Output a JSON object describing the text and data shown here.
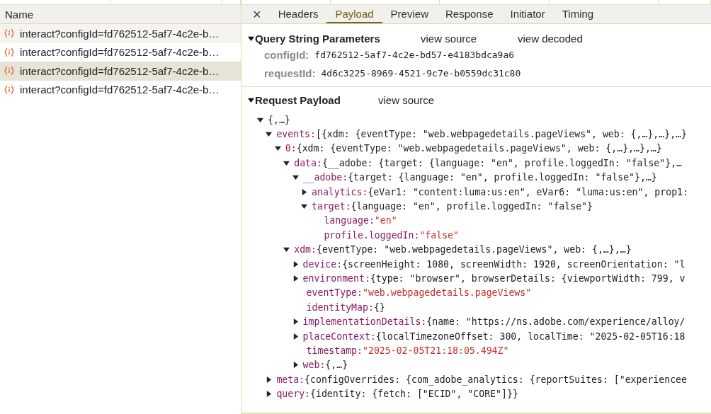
{
  "requests": {
    "header": "Name",
    "items": [
      {
        "name": "interact?configId=fd762512-5af7-4c2e-b…",
        "selected": false
      },
      {
        "name": "interact?configId=fd762512-5af7-4c2e-b…",
        "selected": false
      },
      {
        "name": "interact?configId=fd762512-5af7-4c2e-b…",
        "selected": true
      },
      {
        "name": "interact?configId=fd762512-5af7-4c2e-b…",
        "selected": false
      }
    ]
  },
  "tabs": [
    {
      "label": "×",
      "kind": "close",
      "selected": false
    },
    {
      "label": "Headers",
      "kind": "tab",
      "selected": false
    },
    {
      "label": "Payload",
      "kind": "tab",
      "selected": true
    },
    {
      "label": "Preview",
      "kind": "tab",
      "selected": false
    },
    {
      "label": "Response",
      "kind": "tab",
      "selected": false
    },
    {
      "label": "Initiator",
      "kind": "tab",
      "selected": false
    },
    {
      "label": "Timing",
      "kind": "tab",
      "selected": false
    }
  ],
  "query_string_parameters": {
    "title": "Query String Parameters",
    "expanded": true,
    "links": [
      "view source",
      "view decoded"
    ],
    "params": [
      {
        "name": "configId:",
        "value": "fd762512-5af7-4c2e-bd57-e4183bdca9a6"
      },
      {
        "name": "requestId:",
        "value": "4d6c3225-8969-4521-9c7e-b0559dc31c80"
      }
    ]
  },
  "request_payload": {
    "title": "Request Payload",
    "expanded": true,
    "links": [
      "view source"
    ],
    "tree": [
      {
        "kind": "node",
        "expanded": true,
        "value": "{,…}",
        "children": [
          {
            "kind": "node",
            "expanded": true,
            "key": "events:",
            "value": "[{xdm: {eventType: \"web.webpagedetails.pageViews\", web: {,…},…},…}",
            "children": [
              {
                "kind": "node",
                "expanded": true,
                "key": "0:",
                "value": "{xdm: {eventType: \"web.webpagedetails.pageViews\", web: {,…},…},…}",
                "children": [
                  {
                    "kind": "node",
                    "expanded": true,
                    "key": "data:",
                    "value": "{__adobe: {target: {language: \"en\", profile.loggedIn: \"false\"},…",
                    "children": [
                      {
                        "kind": "node",
                        "expanded": true,
                        "key": "__adobe:",
                        "value": "{target: {language: \"en\", profile.loggedIn: \"false\"},…}",
                        "children": [
                          {
                            "kind": "node",
                            "expanded": false,
                            "key": "analytics:",
                            "value": "{eVar1: \"content:luma:us:en\", eVar6: \"luma:us:en\", prop1:"
                          },
                          {
                            "kind": "node",
                            "expanded": true,
                            "key": "target:",
                            "value": "{language: \"en\", profile.loggedIn: \"false\"}",
                            "children": [
                              {
                                "kind": "string",
                                "key": "language:",
                                "value": "\"en\""
                              },
                              {
                                "kind": "string",
                                "key": "profile.loggedIn:",
                                "value": "\"false\""
                              }
                            ]
                          }
                        ]
                      }
                    ]
                  },
                  {
                    "kind": "node",
                    "expanded": true,
                    "key": "xdm:",
                    "value": "{eventType: \"web.webpagedetails.pageViews\", web: {,…},…}",
                    "children": [
                      {
                        "kind": "node",
                        "expanded": false,
                        "key": "device:",
                        "value": "{screenHeight: 1080, screenWidth: 1920, screenOrientation: \"l"
                      },
                      {
                        "kind": "node",
                        "expanded": false,
                        "key": "environment:",
                        "value": "{type: \"browser\", browserDetails: {viewportWidth: 799, v"
                      },
                      {
                        "kind": "string",
                        "key": "eventType:",
                        "value": "\"web.webpagedetails.pageViews\""
                      },
                      {
                        "kind": "value",
                        "key": "identityMap:",
                        "value": "{}"
                      },
                      {
                        "kind": "node",
                        "expanded": false,
                        "key": "implementationDetails:",
                        "value": "{name: \"https://ns.adobe.com/experience/alloy/"
                      },
                      {
                        "kind": "node",
                        "expanded": false,
                        "key": "placeContext:",
                        "value": "{localTimezoneOffset: 300, localTime: \"2025-02-05T16:18"
                      },
                      {
                        "kind": "string",
                        "key": "timestamp:",
                        "value": "\"2025-02-05T21:18:05.494Z\""
                      },
                      {
                        "kind": "node",
                        "expanded": false,
                        "key": "web:",
                        "value": "{,…}"
                      }
                    ]
                  }
                ]
              }
            ]
          },
          {
            "kind": "node",
            "expanded": false,
            "key": "meta:",
            "value": "{configOverrides: {com_adobe_analytics: {reportSuites: [\"experiencee"
          },
          {
            "kind": "node",
            "expanded": false,
            "key": "query:",
            "value": "{identity: {fetch: [\"ECID\", \"CORE\"]}}"
          }
        ]
      }
    ]
  }
}
